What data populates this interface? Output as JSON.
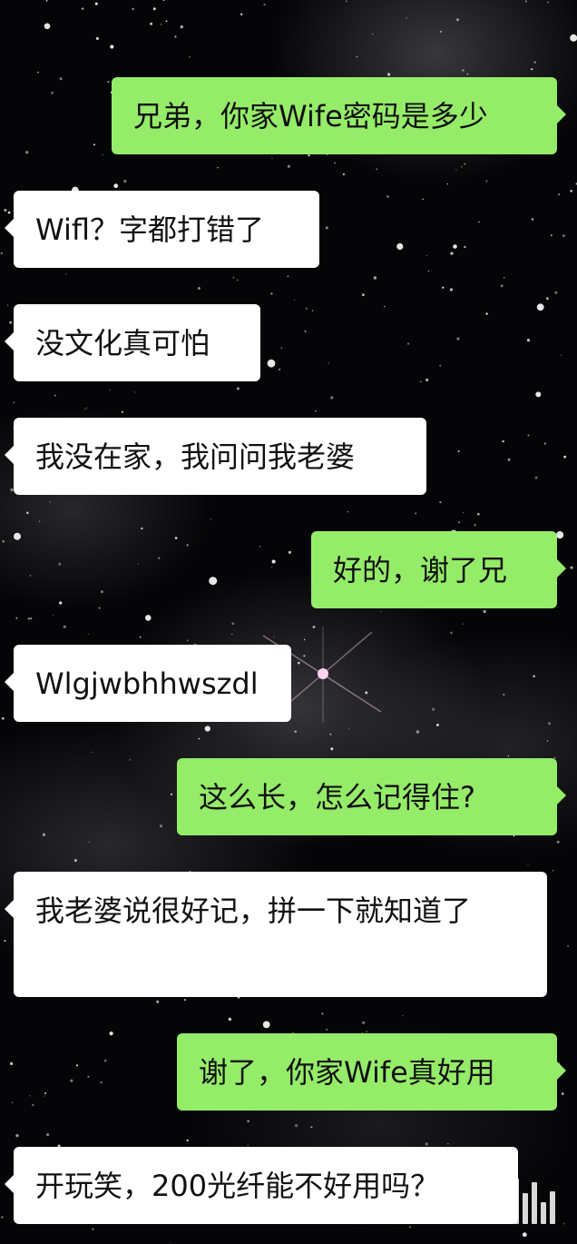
{
  "messages": [
    {
      "side": "right",
      "text": "兄弟，你家Wife密码是多少"
    },
    {
      "side": "left",
      "text": "Wifl？字都打错了"
    },
    {
      "side": "left",
      "text": "没文化真可怕"
    },
    {
      "side": "left",
      "text": "我没在家，我问问我老婆"
    },
    {
      "side": "right",
      "text": "好的，谢了兄"
    },
    {
      "side": "left",
      "text": "Wlgjwbhhwszdl"
    },
    {
      "side": "right",
      "text": "这么长，怎么记得住?"
    },
    {
      "side": "left",
      "text": "我老婆说很好记，拼一下就知道了"
    },
    {
      "side": "right",
      "text": "谢了，你家Wife真好用"
    },
    {
      "side": "left",
      "text": "开玩笑，200光纤能不好用吗？"
    }
  ],
  "colors": {
    "sent_bubble": "#95ec69",
    "received_bubble": "#ffffff",
    "text": "#111111",
    "background": "#050507"
  },
  "icons": {
    "watermark": "watermark-icon"
  }
}
